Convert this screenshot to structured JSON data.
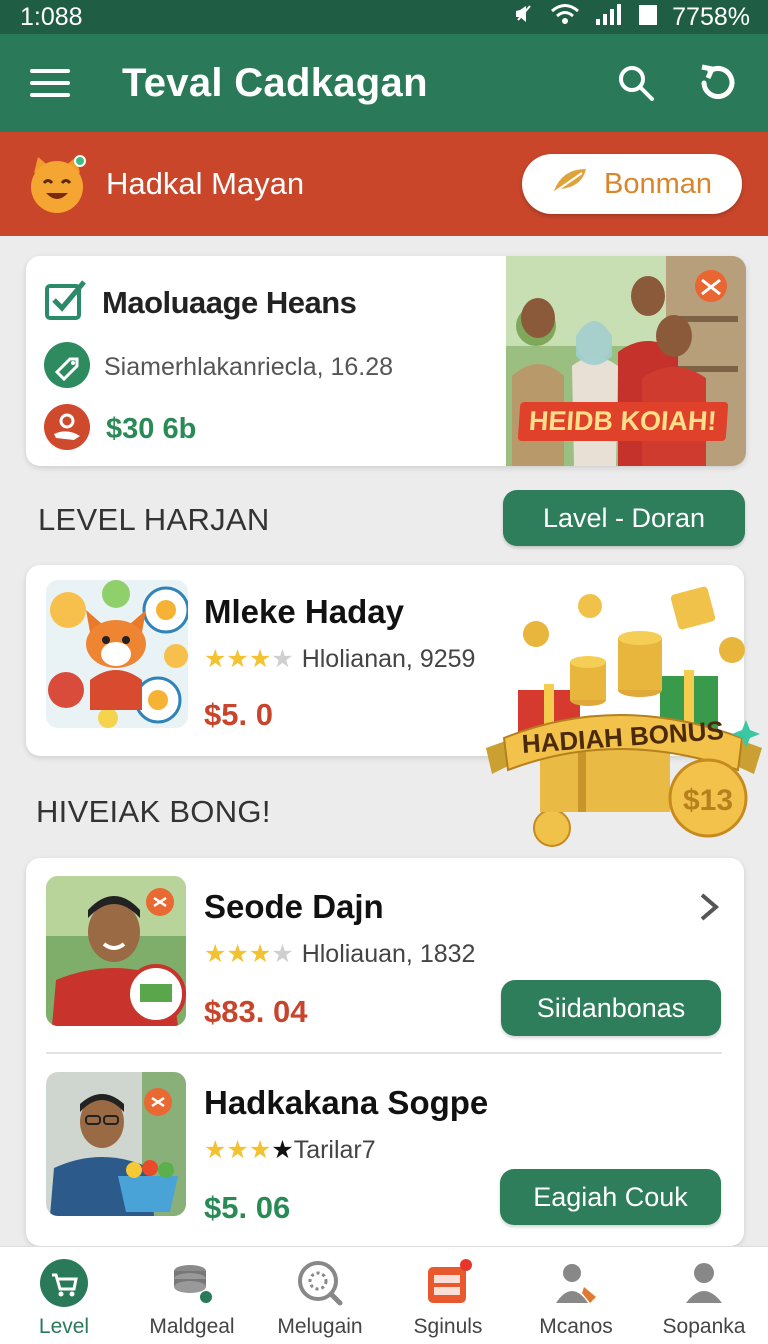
{
  "status_bar": {
    "time": "1:088",
    "battery": "7758%"
  },
  "app_bar": {
    "title": "Teval Cadkagan"
  },
  "promo": {
    "text": "Hadkal Mayan",
    "button_label": "Bonman"
  },
  "featured": {
    "title": "Maoluaage Heans",
    "subtitle": "Siamerhlakanriecla, 16.28",
    "price": "$30 6b",
    "photo_tag": "HEIDB KOIAH!"
  },
  "level_section": {
    "title": "LEVEL HARJAN",
    "button_label": "Lavel - Doran"
  },
  "level_item": {
    "title": "Mleke Haday",
    "rating_text": "Hlolianan, 9259",
    "rating": 3,
    "price": "$5. 0"
  },
  "bonus_banner": {
    "text": "HADIAH BONUS",
    "coin_text": "$13"
  },
  "hiveiak_section": {
    "title": "HIVEIAK BONG!"
  },
  "list_items": [
    {
      "title": "Seode Dajn",
      "rating_text": "Hloliauan, 1832",
      "rating": 3,
      "price": "$83. 04",
      "button_label": "Siidanbonas",
      "price_color": "#c8452b"
    },
    {
      "title": "Hadkakana Sogpe",
      "rating_text": "Tarilar7",
      "rating": 3,
      "price": "$5. 06",
      "button_label": "Eagiah Couk",
      "price_color": "#2a8a55"
    }
  ],
  "bottom_nav": [
    {
      "label": "Level",
      "icon": "cart-icon",
      "active": true
    },
    {
      "label": "Maldgeal",
      "icon": "coins-icon"
    },
    {
      "label": "Melugain",
      "icon": "gear-search-icon"
    },
    {
      "label": "Sginuls",
      "icon": "inbox-icon",
      "badge": "1"
    },
    {
      "label": "Mcanos",
      "icon": "users-icon"
    },
    {
      "label": "Sopanka",
      "icon": "person-icon"
    }
  ],
  "colors": {
    "primary": "#2a7a59",
    "status_bar": "#1f5e45",
    "promo": "#c9462a",
    "price_green": "#2a8a55",
    "price_red": "#c8452b"
  }
}
